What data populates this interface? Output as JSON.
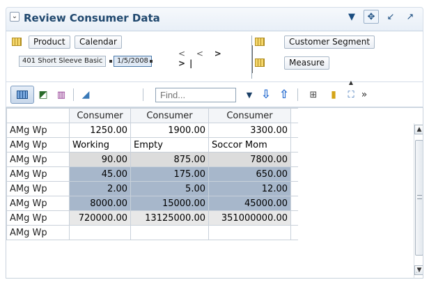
{
  "header": {
    "collapse_glyph": "⌄",
    "title": "Review Consumer Data"
  },
  "layout": {
    "row_dims": [
      "Product",
      "Calendar"
    ],
    "page_items": [
      "401 Short Sleeve Basic",
      "1/5/2008"
    ],
    "col_dims": [
      "Customer Segment",
      "Measure"
    ]
  },
  "toolbar": {
    "find_placeholder": "Find..."
  },
  "grid": {
    "column_headers": [
      "Consumer",
      "Consumer",
      "Consumer"
    ],
    "rows": [
      {
        "label": "AMg Wp",
        "style": "white",
        "values": [
          "1250.00",
          "1900.00",
          "3300.00"
        ],
        "align": "num"
      },
      {
        "label": "AMg Wp",
        "style": "white",
        "values": [
          "Working",
          "Empty",
          "Soccor Mom"
        ],
        "align": "text"
      },
      {
        "label": "AMg Wp",
        "style": "gray",
        "values": [
          "90.00",
          "875.00",
          "7800.00"
        ],
        "align": "num"
      },
      {
        "label": "AMg Wp",
        "style": "blue",
        "values": [
          "45.00",
          "175.00",
          "650.00"
        ],
        "align": "num"
      },
      {
        "label": "AMg Wp",
        "style": "blue",
        "values": [
          "2.00",
          "5.00",
          "12.00"
        ],
        "align": "num"
      },
      {
        "label": "AMg Wp",
        "style": "blue",
        "values": [
          "8000.00",
          "15000.00",
          "45000.00"
        ],
        "align": "num"
      },
      {
        "label": "AMg Wp",
        "style": "lgray",
        "values": [
          "720000.00",
          "13125000.00",
          "351000000.00"
        ],
        "align": "num"
      },
      {
        "label": "AMg Wp",
        "style": "white",
        "values": [
          "",
          "",
          ""
        ],
        "align": "num"
      }
    ]
  },
  "colors": {
    "title": "#20486e",
    "cell_blue": "#a7b7cb",
    "cell_gray": "#dcdcdc"
  }
}
